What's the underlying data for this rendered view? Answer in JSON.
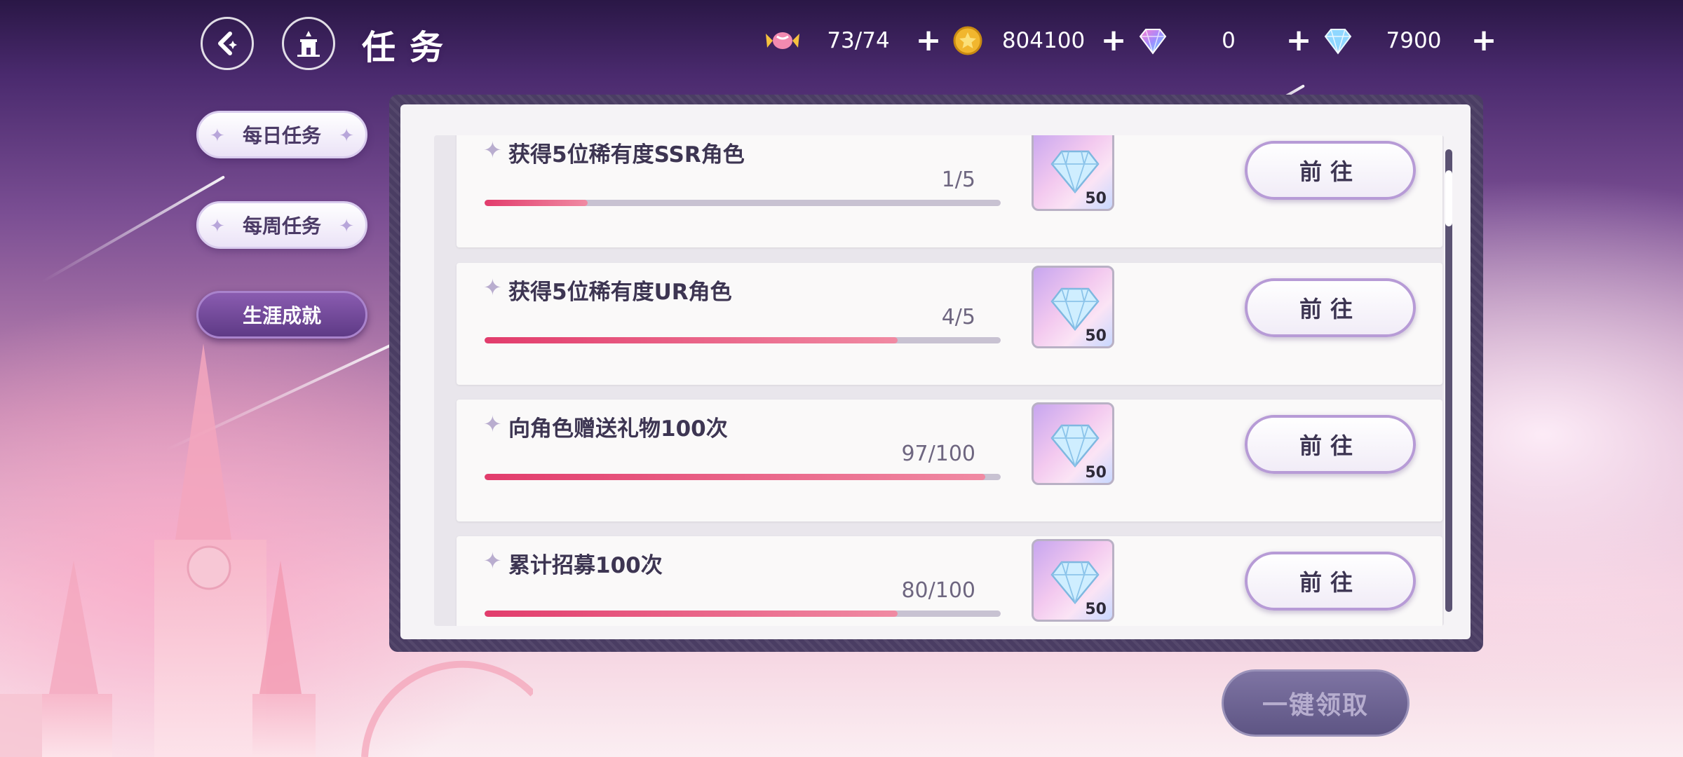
{
  "header": {
    "title": "任务",
    "resources": [
      {
        "icon": "candy-icon",
        "value": "73/74"
      },
      {
        "icon": "gold-coin-icon",
        "value": "804100"
      },
      {
        "icon": "rainbow-gem-icon",
        "value": "0"
      },
      {
        "icon": "blue-diamond-icon",
        "value": "7900"
      }
    ]
  },
  "tabs": [
    {
      "label": "每日任务",
      "active": false
    },
    {
      "label": "每周任务",
      "active": false
    },
    {
      "label": "生涯成就",
      "active": true
    }
  ],
  "tasks": [
    {
      "title": "获得5位稀有度SSR角色",
      "progress": "1/5",
      "ratio": 0.2,
      "reward_qty": "50",
      "button": "前往"
    },
    {
      "title": "获得5位稀有度UR角色",
      "progress": "4/5",
      "ratio": 0.8,
      "reward_qty": "50",
      "button": "前往"
    },
    {
      "title": "向角色赠送礼物100次",
      "progress": "97/100",
      "ratio": 0.97,
      "reward_qty": "50",
      "button": "前往"
    },
    {
      "title": "累计招募100次",
      "progress": "80/100",
      "ratio": 0.8,
      "reward_qty": "50",
      "button": "前往"
    }
  ],
  "claim_all": "一键领取",
  "colors": {
    "accent": "#5e3a86",
    "progress": "#e23c6c",
    "panel": "#4a3d63"
  }
}
